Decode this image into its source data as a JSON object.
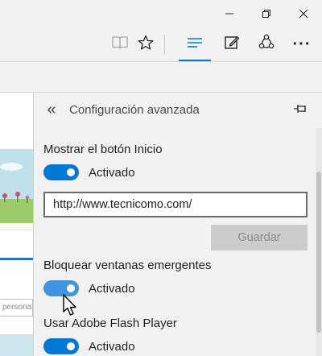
{
  "window": {
    "minimize_icon": "minimize-icon",
    "restore_icon": "restore-icon",
    "close_icon": "close-icon"
  },
  "toolbar": {
    "icons": [
      "reading-view-icon",
      "favorite-star-icon",
      "hub-icon",
      "web-note-icon",
      "share-icon",
      "more-icon"
    ],
    "more_label": "···",
    "accent": "#0078d7"
  },
  "page": {
    "search_placeholder": "persona"
  },
  "panel": {
    "back_label": "«",
    "title": "Configuración avanzada",
    "sections": [
      {
        "label": "Mostrar el botón Inicio",
        "toggle_state": "Activado",
        "on": true
      },
      {
        "label": "Bloquear ventanas emergentes",
        "toggle_state": "Activado",
        "on": true
      },
      {
        "label": "Usar Adobe Flash Player",
        "toggle_state": "Activado",
        "on": true
      }
    ],
    "home_url": "http://www.tecnicomo.com/",
    "save_label": "Guardar"
  }
}
